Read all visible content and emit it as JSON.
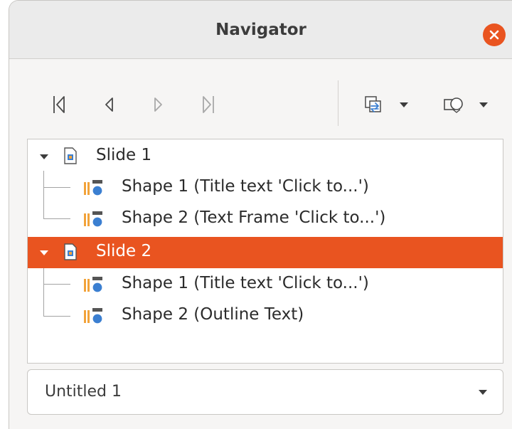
{
  "window": {
    "title": "Navigator"
  },
  "toolbar": {
    "first": "first-slide-icon",
    "previous": "previous-slide-icon",
    "next": "next-slide-icon",
    "last": "last-slide-icon",
    "drag_mode": "drag-mode-icon",
    "shapes": "show-shapes-icon"
  },
  "tree": {
    "items": [
      {
        "label": "Slide 1",
        "level": 0
      },
      {
        "label": "Shape 1 (Title text 'Click to...')",
        "level": 1
      },
      {
        "label": "Shape 2 (Text Frame 'Click to...')",
        "level": 1
      },
      {
        "label": "Slide 2",
        "level": 0,
        "selected": true
      },
      {
        "label": "Shape 1 (Title text 'Click to...')",
        "level": 1
      },
      {
        "label": "Shape 2 (Outline Text)",
        "level": 1
      }
    ]
  },
  "document_select": {
    "value": "Untitled 1"
  },
  "colors": {
    "accent": "#e95420",
    "background": "#f6f5f4",
    "titlebar": "#ebebeb"
  }
}
